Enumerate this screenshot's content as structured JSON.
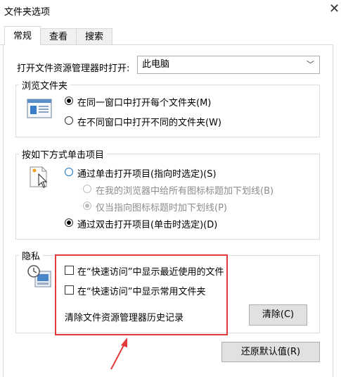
{
  "window": {
    "title": "文件夹选项",
    "close_glyph": "✕"
  },
  "tabs": [
    {
      "label": "常规",
      "active": true
    },
    {
      "label": "查看",
      "active": false
    },
    {
      "label": "搜索",
      "active": false
    }
  ],
  "open_explorer": {
    "label": "打开文件资源管理器时打开:",
    "value": "此电脑"
  },
  "browse_folders": {
    "title": "浏览文件夹",
    "options": [
      {
        "label": "在同一窗口中打开每个文件夹(M)",
        "checked": true
      },
      {
        "label": "在不同窗口中打开不同的文件夹(W)",
        "checked": false
      }
    ]
  },
  "click_items": {
    "title": "按如下方式单击项目",
    "options": [
      {
        "label": "通过单击打开项目(指向时选定)(S)",
        "checked": false
      },
      {
        "label": "在我的浏览器中给所有图标标题加下划线(B)",
        "checked": false,
        "disabled": true
      },
      {
        "label": "仅当指向图标标题时加下划线(P)",
        "checked": true,
        "disabled": true
      },
      {
        "label": "通过双击打开项目(单击时选定)(D)",
        "checked": true
      }
    ]
  },
  "privacy": {
    "title": "隐私",
    "checkboxes": [
      {
        "label": "在“快速访问”中显示最近使用的文件",
        "checked": false
      },
      {
        "label": "在“快速访问”中显示常用文件夹",
        "checked": false
      }
    ],
    "clear_history_label": "清除文件资源管理器历史记录",
    "clear_button": "清除(C)"
  },
  "restore_defaults_button": "还原默认值(R)",
  "colors": {
    "highlight_red": "#e23a3a",
    "radio_blue": "#1a73c8"
  }
}
